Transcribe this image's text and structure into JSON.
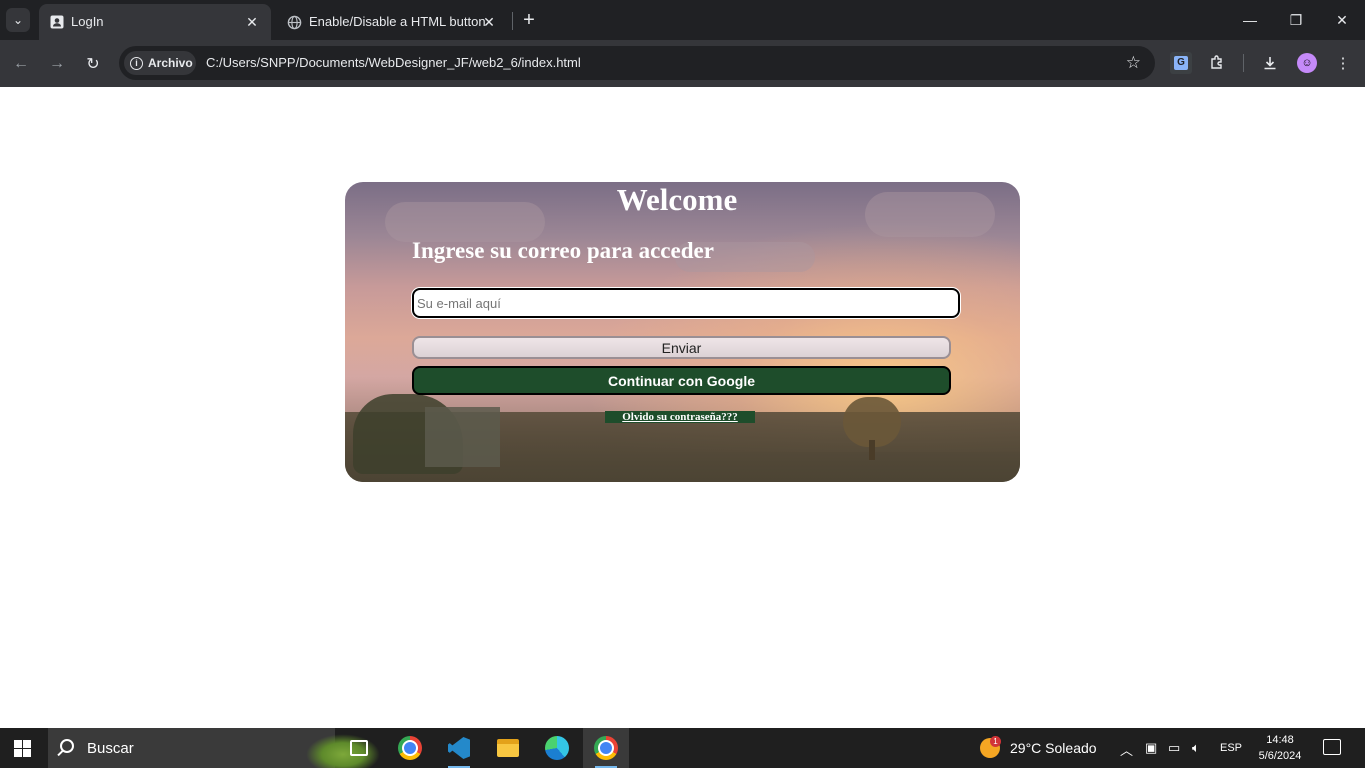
{
  "browser": {
    "tabs": [
      {
        "title": "LogIn",
        "active": true
      },
      {
        "title": "Enable/Disable a HTML button",
        "active": false
      }
    ],
    "site_chip": "Archivo",
    "url": "C:/Users/SNPP/Documents/WebDesigner_JF/web2_6/index.html"
  },
  "page": {
    "welcome": "Welcome",
    "subtitle": "Ingrese su correo para acceder",
    "email_placeholder": "Su e-mail aquí",
    "email_value": "",
    "send_button": "Enviar",
    "google_button": "Continuar con Google",
    "forgot_link": "Olvido su contraseña???"
  },
  "taskbar": {
    "search_placeholder": "Buscar",
    "weather_badge": "1",
    "weather": "29°C  Soleado",
    "language": "ESP",
    "time": "14:48",
    "date": "5/6/2024"
  },
  "colors": {
    "button_green": "#1e4d2b",
    "chrome_dark": "#202124",
    "chrome_toolbar": "#35363a",
    "taskbar": "#1f1f1f"
  }
}
